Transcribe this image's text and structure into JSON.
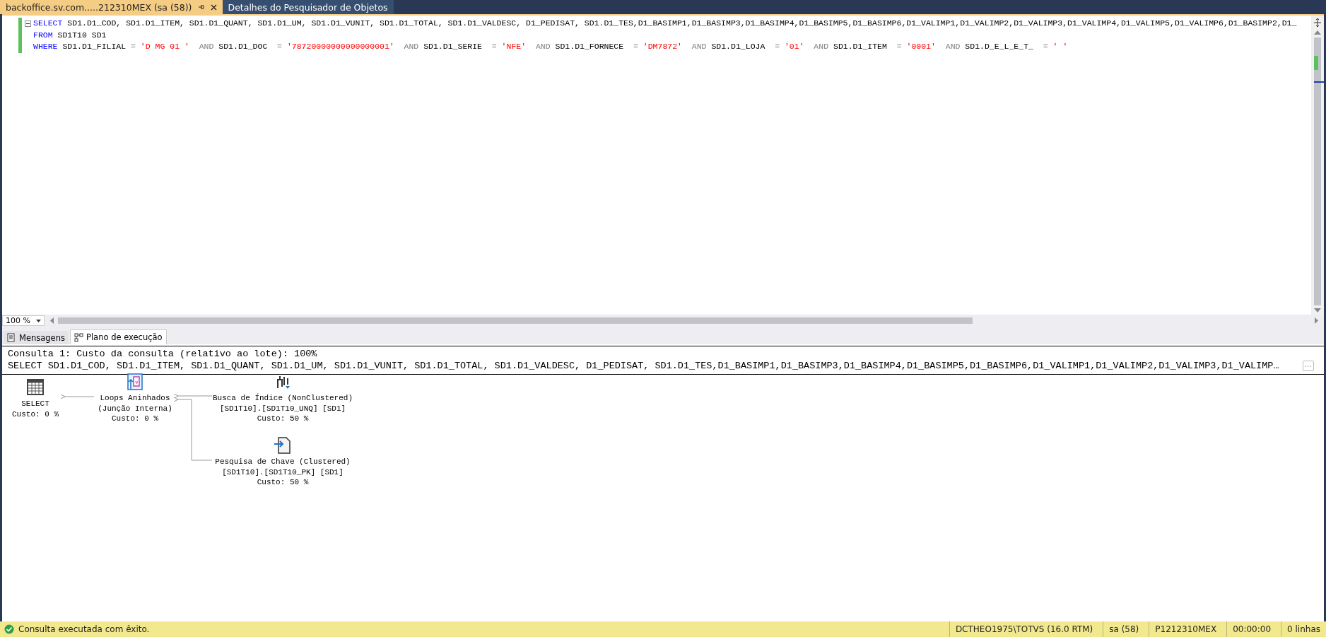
{
  "document_tabs": [
    {
      "label": "backoffice.sv.com.....212310MEX (sa (58))",
      "selected": true
    },
    {
      "label": "Detalhes do Pesquisador de Objetos",
      "selected": false
    }
  ],
  "editor": {
    "lines": [
      {
        "tokens": [
          {
            "kind": "keyword",
            "text": "SELECT"
          },
          {
            "kind": "plain",
            "text": " SD1.D1_COD, SD1.D1_ITEM, SD1.D1_QUANT, SD1.D1_UM, SD1.D1_VUNIT, SD1.D1_TOTAL, SD1.D1_VALDESC, D1_PEDISAT, SD1.D1_TES,D1_BASIMP1,D1_BASIMP3,D1_BASIMP4,D1_BASIMP5,D1_BASIMP6,D1_VALIMP1,D1_VALIMP2,D1_VALIMP3,D1_VALIMP4,D1_VALIMP5,D1_VALIMP6,D1_BASIMP2,D1_"
          }
        ]
      },
      {
        "tokens": [
          {
            "kind": "keyword",
            "text": "FROM"
          },
          {
            "kind": "plain",
            "text": " SD1T10 SD1"
          }
        ]
      },
      {
        "tokens": [
          {
            "kind": "keyword",
            "text": "WHERE"
          },
          {
            "kind": "plain",
            "text": " SD1.D1_FILIAL "
          },
          {
            "kind": "operator",
            "text": "="
          },
          {
            "kind": "string",
            "text": " 'D MG 01 '"
          },
          {
            "kind": "operator",
            "text": "  AND"
          },
          {
            "kind": "plain",
            "text": " SD1.D1_DOC  "
          },
          {
            "kind": "operator",
            "text": "="
          },
          {
            "kind": "string",
            "text": " '78720000000000000001'"
          },
          {
            "kind": "operator",
            "text": "  AND"
          },
          {
            "kind": "plain",
            "text": " SD1.D1_SERIE  "
          },
          {
            "kind": "operator",
            "text": "="
          },
          {
            "kind": "string",
            "text": " 'NFE'"
          },
          {
            "kind": "operator",
            "text": "  AND"
          },
          {
            "kind": "plain",
            "text": " SD1.D1_FORNECE  "
          },
          {
            "kind": "operator",
            "text": "="
          },
          {
            "kind": "string",
            "text": " 'DM7872'"
          },
          {
            "kind": "operator",
            "text": "  AND"
          },
          {
            "kind": "plain",
            "text": " SD1.D1_LOJA  "
          },
          {
            "kind": "operator",
            "text": "="
          },
          {
            "kind": "string",
            "text": " '01'"
          },
          {
            "kind": "operator",
            "text": "  AND"
          },
          {
            "kind": "plain",
            "text": " SD1.D1_ITEM  "
          },
          {
            "kind": "operator",
            "text": "="
          },
          {
            "kind": "string",
            "text": " '0001'"
          },
          {
            "kind": "operator",
            "text": "  AND"
          },
          {
            "kind": "plain",
            "text": " SD1.D_E_L_E_T_  "
          },
          {
            "kind": "operator",
            "text": "="
          },
          {
            "kind": "string",
            "text": " ' '"
          }
        ]
      }
    ],
    "zoom": "100 %"
  },
  "result_tabs": [
    {
      "label": "Mensagens",
      "selected": false
    },
    {
      "label": "Plano de execução",
      "selected": true
    }
  ],
  "plan": {
    "header": "Consulta 1: Custo da consulta (relativo ao lote): 100%",
    "statement": "SELECT SD1.D1_COD, SD1.D1_ITEM, SD1.D1_QUANT, SD1.D1_UM, SD1.D1_VUNIT, SD1.D1_TOTAL, SD1.D1_VALDESC, D1_PEDISAT, SD1.D1_TES,D1_BASIMP1,D1_BASIMP3,D1_BASIMP4,D1_BASIMP5,D1_BASIMP6,D1_VALIMP1,D1_VALIMP2,D1_VALIMP3,D1_VALIMP…",
    "nodes": [
      {
        "kind": "select",
        "lines": [
          "SELECT",
          "Custo: 0 %"
        ]
      },
      {
        "kind": "loops",
        "lines": [
          "Loops Aninhados",
          "(Junção Interna)",
          "Custo: 0 %"
        ]
      },
      {
        "kind": "seek",
        "lines": [
          "Busca de Índice (NonClustered)",
          "[SD1T10].[SD1T10_UNQ] [SD1]",
          "Custo: 50 %"
        ]
      },
      {
        "kind": "lookup",
        "lines": [
          "Pesquisa de Chave (Clustered)",
          "[SD1T10].[SD1T10_PK] [SD1]",
          "Custo: 50 %"
        ]
      }
    ]
  },
  "status_bar": {
    "message": "Consulta executada com êxito.",
    "cells": [
      "DCTHEO1975\\TOTVS (16.0 RTM)",
      "sa (58)",
      "P1212310MEX",
      "00:00:00",
      "0 linhas"
    ]
  }
}
